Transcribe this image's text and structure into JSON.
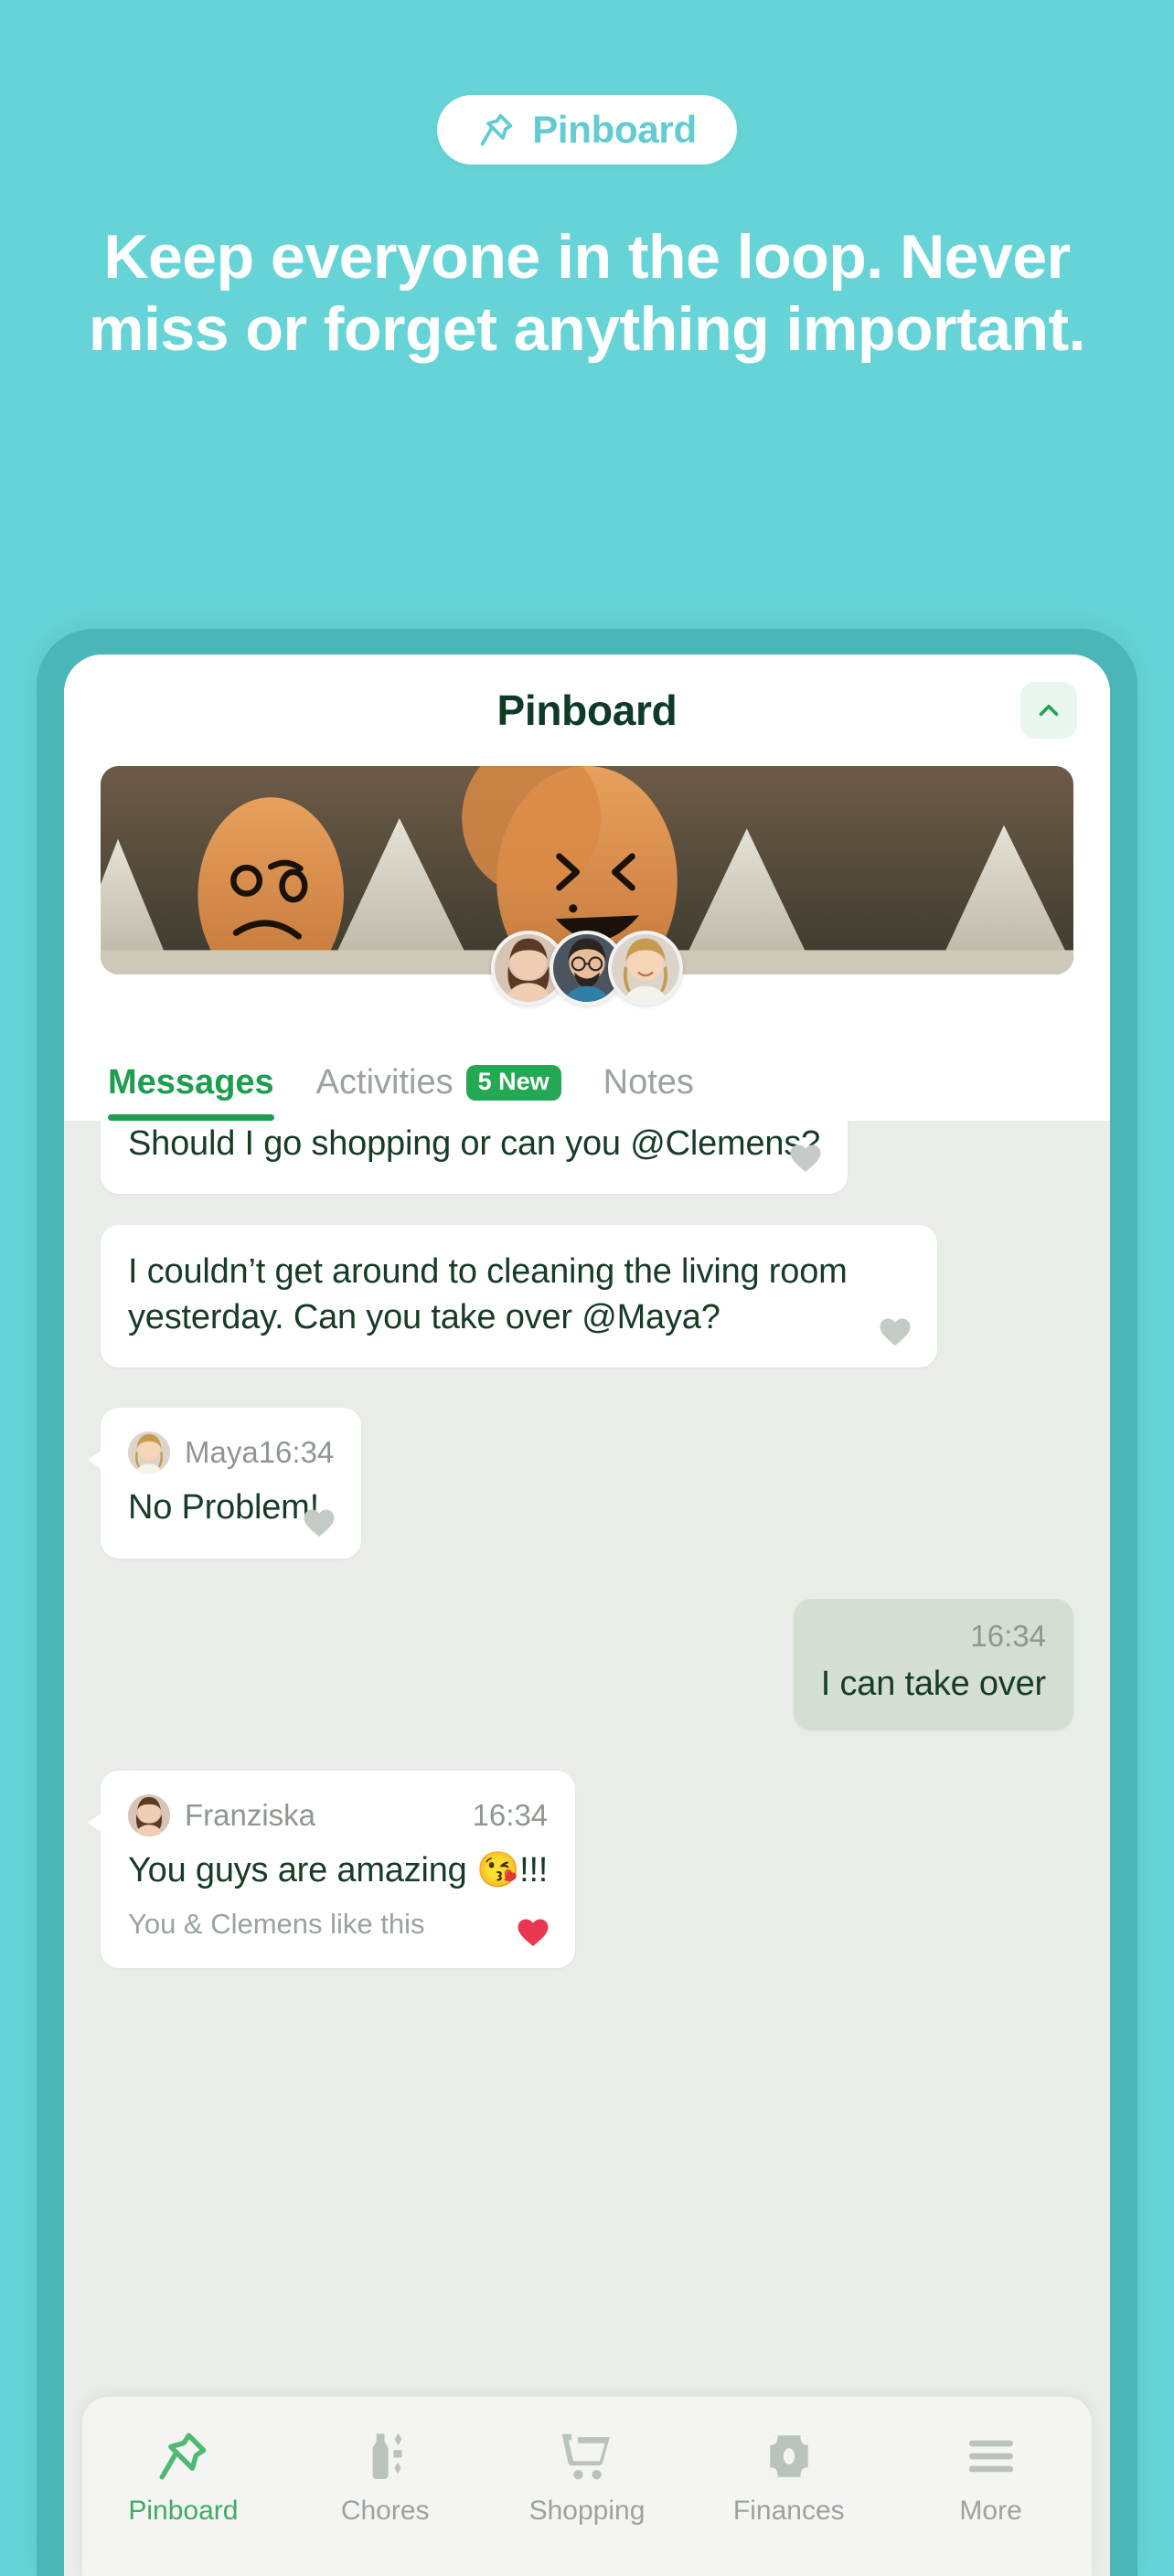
{
  "promo": {
    "pill_label": "Pinboard",
    "pill_icon": "pin-icon",
    "headline": "Keep everyone in the loop. Never miss or forget anything important."
  },
  "colors": {
    "background": "#66d4d6",
    "phone_frame": "#4bb6b8",
    "brand_teal": "#63ccd2",
    "accent_green": "#1d9d4f",
    "badge_green": "#25a854",
    "text_dark_green": "#0d3b25",
    "bubble_in": "#ffffff",
    "bubble_out": "#d4ded3",
    "chat_background": "#e9ede8",
    "muted_text": "#8e9790",
    "heart_liked": "#e8384f",
    "heart_idle": "#c4cbc4"
  },
  "app": {
    "header": {
      "title": "Pinboard",
      "collapse_icon": "chevron-up-icon"
    },
    "cover": {
      "alt": "eggs-with-drawn-faces-in-carton",
      "members": [
        "franziska-avatar",
        "clemens-avatar",
        "maya-avatar"
      ]
    },
    "tabs": [
      {
        "label": "Messages",
        "active": true,
        "badge": null
      },
      {
        "label": "Activities",
        "active": false,
        "badge": "5 New"
      },
      {
        "label": "Notes",
        "active": false,
        "badge": null
      }
    ],
    "messages": [
      {
        "id": "msg-1",
        "direction": "in",
        "sender": null,
        "time": null,
        "text": "Should I go shopping or can you @Clemens?",
        "liked": false,
        "like_text": null
      },
      {
        "id": "msg-2",
        "direction": "in",
        "sender": null,
        "time": null,
        "text": "I couldn’t get around to cleaning the living room yesterday. Can you take over @Maya?",
        "liked": false,
        "like_text": null
      },
      {
        "id": "msg-3",
        "direction": "in",
        "sender": "Maya",
        "time": "16:34",
        "text": "No Problem!",
        "liked": false,
        "like_text": null
      },
      {
        "id": "msg-4",
        "direction": "out",
        "sender": null,
        "time": "16:34",
        "text": "I can take over",
        "liked": false,
        "like_text": null
      },
      {
        "id": "msg-5",
        "direction": "in",
        "sender": "Franziska",
        "time": "16:34",
        "text": "You guys are amazing 😘!!!",
        "liked": true,
        "like_text": "You & Clemens like this"
      }
    ],
    "bottom_nav": [
      {
        "label": "Pinboard",
        "icon": "pin-icon",
        "active": true
      },
      {
        "label": "Chores",
        "icon": "bottle-icon",
        "active": false
      },
      {
        "label": "Shopping",
        "icon": "cart-icon",
        "active": false
      },
      {
        "label": "Finances",
        "icon": "banknote-icon",
        "active": false
      },
      {
        "label": "More",
        "icon": "menu-icon",
        "active": false
      }
    ]
  }
}
